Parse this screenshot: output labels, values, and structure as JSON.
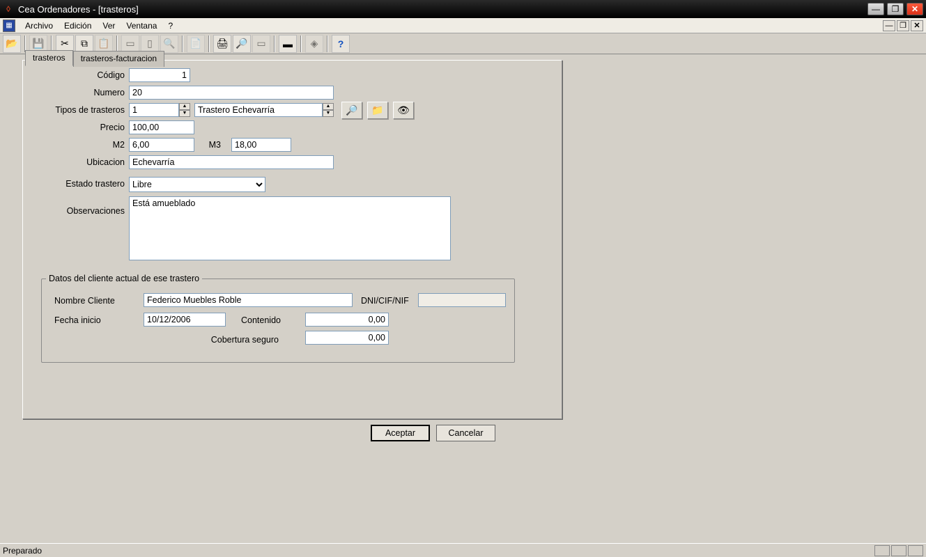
{
  "window": {
    "title": "Cea Ordenadores  - [trasteros]"
  },
  "menu": {
    "items": [
      "Archivo",
      "Edición",
      "Ver",
      "Ventana",
      "?"
    ]
  },
  "tabs": {
    "active": "trasteros",
    "other": "trasteros-facturacion"
  },
  "labels": {
    "codigo": "Código",
    "numero": "Numero",
    "tipos": "Tipos de trasteros",
    "precio": "Precio",
    "m2": "M2",
    "m3": "M3",
    "ubicacion": "Ubicacion",
    "estado": "Estado trastero",
    "observaciones": "Observaciones",
    "fieldset": "Datos del cliente actual de ese trastero",
    "nombre_cliente": "Nombre Cliente",
    "dni": "DNI/CIF/NIF",
    "fecha_inicio": "Fecha inicio",
    "contenido": "Contenido",
    "cobertura": "Cobertura seguro"
  },
  "values": {
    "codigo": "1",
    "numero": "20",
    "tipo_num": "1",
    "tipo_nombre": "Trastero Echevarría",
    "precio": "100,00",
    "m2": "6,00",
    "m3": "18,00",
    "ubicacion": "Echevarría",
    "estado": "Libre",
    "observaciones": "Está amueblado",
    "nombre_cliente": "Federico Muebles Roble",
    "dni": "",
    "fecha_inicio": "10/12/2006",
    "contenido": "0,00",
    "cobertura": "0,00"
  },
  "buttons": {
    "aceptar": "Aceptar",
    "cancelar": "Cancelar"
  },
  "status": {
    "text": "Preparado"
  }
}
